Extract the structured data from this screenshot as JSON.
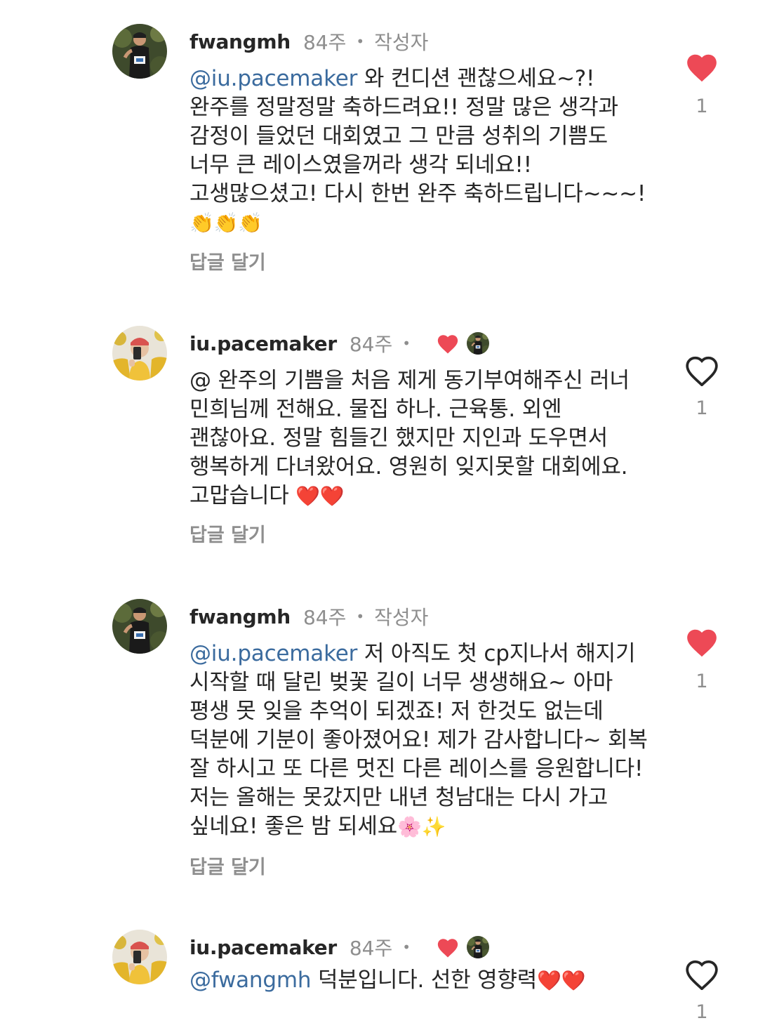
{
  "comments": [
    {
      "username": "fwangmh",
      "time": "84주",
      "separator": "•",
      "author_tag": "작성자",
      "mention": "@iu.pacemaker",
      "text": " 와 컨디션 괜찮으세요~?! 완주를 정말정말 축하드려요!! 정말 많은 생각과 감정이 들었던 대회였고 그 만큼 성취의 기쁨도 너무 큰 레이스였을꺼라 생각 되네요!! 고생많으셨고! 다시 한번 완주 축하드립니다~~~! ",
      "emoji": "👏👏👏",
      "reply_label": "답글 달기",
      "liked": true,
      "like_count": "1"
    },
    {
      "username": "iu.pacemaker",
      "time": "84주",
      "separator": "•",
      "liked_by_author": true,
      "mention": "",
      "text": "@ 완주의 기쁨을 처음 제게 동기부여해주신 러너 민희님께 전해요. 물집 하나. 근육통. 외엔 괜찮아요. 정말 힘들긴 했지만 지인과 도우면서 행복하게 다녀왔어요. 영원히 잊지못할 대회에요. 고맙습니다 ",
      "emoji": "❤️❤️",
      "reply_label": "답글 달기",
      "liked": false,
      "like_count": "1"
    },
    {
      "username": "fwangmh",
      "time": "84주",
      "separator": "•",
      "author_tag": "작성자",
      "mention": "@iu.pacemaker",
      "text": " 저 아직도 첫 cp지나서 해지기 시작할 때 달린 벚꽃 길이 너무 생생해요~ 아마 평생 못 잊을 추억이 되겠죠! 저 한것도 없는데 덕분에 기분이 좋아졌어요! 제가 감사합니다~ 회복 잘 하시고 또 다른 멋진 다른 레이스를 응원합니다! 저는 올해는 못갔지만 내년 청남대는 다시 가고 싶네요! 좋은 밤 되세요",
      "emoji": "🌸✨",
      "reply_label": "답글 달기",
      "liked": true,
      "like_count": "1"
    },
    {
      "username": "iu.pacemaker",
      "time": "84주",
      "separator": "•",
      "liked_by_author": true,
      "mention": "@fwangmh",
      "text": " 덕분입니다. 선한 영향력",
      "emoji": "❤️❤️",
      "liked": false,
      "like_count": "1"
    }
  ],
  "colors": {
    "like_red": "#ed4956",
    "mention_blue": "#3b6b9e",
    "muted_gray": "#8e8e8e"
  },
  "icons": {
    "like_filled": "heart-filled-icon",
    "like_outline": "heart-outline-icon"
  }
}
